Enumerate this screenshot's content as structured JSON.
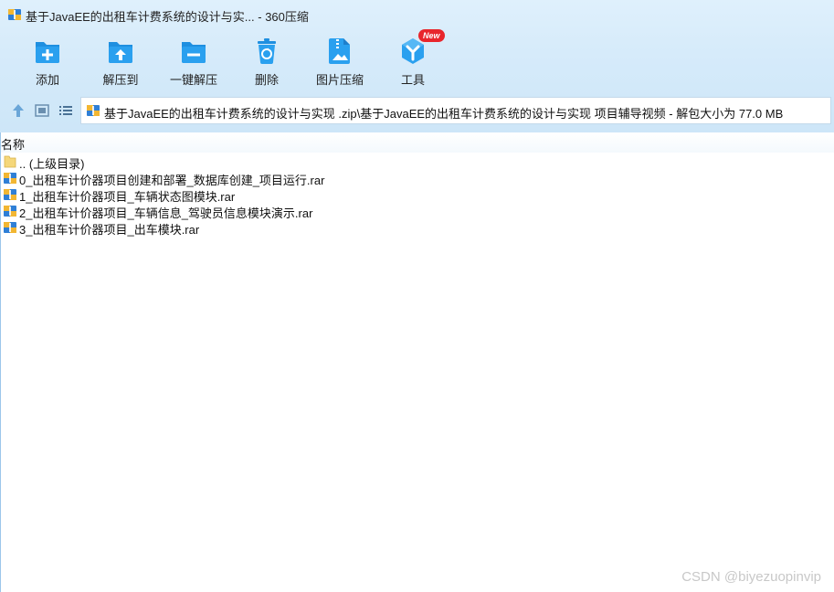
{
  "window": {
    "title": "基于JavaEE的出租车计费系统的设计与实... - 360压缩"
  },
  "toolbar": {
    "items": [
      {
        "label": "添加",
        "icon": "add-icon"
      },
      {
        "label": "解压到",
        "icon": "extract-to-icon"
      },
      {
        "label": "一键解压",
        "icon": "one-click-extract-icon"
      },
      {
        "label": "删除",
        "icon": "delete-icon"
      },
      {
        "label": "图片压缩",
        "icon": "image-compress-icon"
      },
      {
        "label": "工具",
        "icon": "tools-icon",
        "badge": "New"
      }
    ]
  },
  "navigation": {
    "path": "基于JavaEE的出租车计费系统的设计与实现 .zip\\基于JavaEE的出租车计费系统的设计与实现 项目辅导视频 - 解包大小为 77.0 MB",
    "buttons": [
      "up-arrow-icon",
      "thumbnail-view-icon",
      "list-view-icon"
    ]
  },
  "columns": {
    "name": "名称"
  },
  "files": [
    {
      "name": ".. (上级目录)",
      "type": "parent-folder"
    },
    {
      "name": "0_出租车计价器项目创建和部署_数据库创建_项目运行.rar",
      "type": "rar"
    },
    {
      "name": "1_出租车计价器项目_车辆状态图模块.rar",
      "type": "rar"
    },
    {
      "name": "2_出租车计价器项目_车辆信息_驾驶员信息模块演示.rar",
      "type": "rar"
    },
    {
      "name": "3_出租车计价器项目_出车模块.rar",
      "type": "rar"
    }
  ],
  "watermark": "CSDN @biyezuopinvip",
  "colors": {
    "chrome_bg": "#d6ebfa",
    "icon_blue": "#1e8fe0",
    "badge_red": "#e8262c",
    "folder_yellow": "#f5d77a"
  }
}
